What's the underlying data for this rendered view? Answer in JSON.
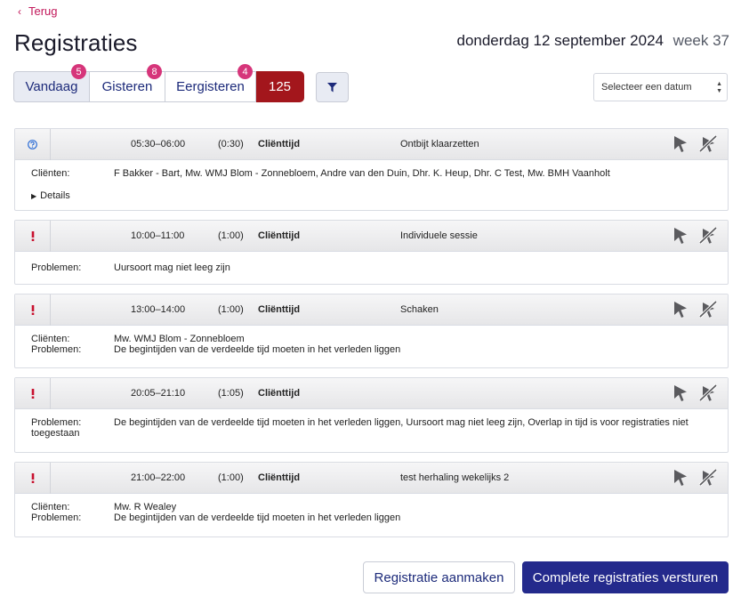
{
  "nav": {
    "back_label": "Terug"
  },
  "header": {
    "title": "Registraties",
    "date": "donderdag 12 september 2024",
    "week": "week 37"
  },
  "day_tabs": [
    {
      "label": "Vandaag",
      "badge": "5"
    },
    {
      "label": "Gisteren",
      "badge": "8"
    },
    {
      "label": "Eergisteren",
      "badge": "4"
    }
  ],
  "total_count": "125",
  "date_select": {
    "placeholder": "Selecteer een datum"
  },
  "registrations": [
    {
      "status": "question",
      "time": "05:30–06:00",
      "duration": "(0:30)",
      "type": "Cliënttijd",
      "activity": "Ontbijt klaarzetten",
      "rows": [
        {
          "label": "Cliënten:",
          "value": "F Bakker - Bart, Mw. WMJ Blom - Zonnebloem, Andre van den Duin, Dhr. K. Heup, Dhr. C Test, Mw. BMH Vaanholt"
        }
      ],
      "details_label": "Details"
    },
    {
      "status": "error",
      "time": "10:00–11:00",
      "duration": "(1:00)",
      "type": "Cliënttijd",
      "activity": "Individuele sessie",
      "rows": [
        {
          "label": "Problemen:",
          "value": "Uursoort mag niet leeg zijn"
        }
      ]
    },
    {
      "status": "error",
      "time": "13:00–14:00",
      "duration": "(1:00)",
      "type": "Cliënttijd",
      "activity": "Schaken",
      "rows": [
        {
          "label": "Cliënten:",
          "value": "Mw. WMJ Blom - Zonnebloem"
        },
        {
          "label": "Problemen:",
          "value": "De begintijden van de verdeelde tijd moeten in het verleden liggen"
        }
      ]
    },
    {
      "status": "error",
      "time": "20:05–21:10",
      "duration": "(1:05)",
      "type": "Cliënttijd",
      "activity": "",
      "rows": [
        {
          "label": "Problemen:",
          "value": "De begintijden van de verdeelde tijd moeten in het verleden liggen, Uursoort mag niet leeg zijn, Overlap in tijd is voor registraties niet toegestaan"
        }
      ]
    },
    {
      "status": "error",
      "time": "21:00–22:00",
      "duration": "(1:00)",
      "type": "Cliënttijd",
      "activity": "test herhaling wekelijks 2",
      "rows": [
        {
          "label": "Cliënten:",
          "value": "Mw. R Wealey"
        },
        {
          "label": "Problemen:",
          "value": "De begintijden van de verdeelde tijd moeten in het verleden liggen"
        }
      ]
    }
  ],
  "footer": {
    "create_label": "Registratie aanmaken",
    "submit_label": "Complete registraties versturen"
  },
  "colors": {
    "accent": "#242a8c",
    "badge": "#d6357a",
    "count": "#a3161c",
    "error": "#c8102e",
    "info": "#2f6fd6"
  }
}
